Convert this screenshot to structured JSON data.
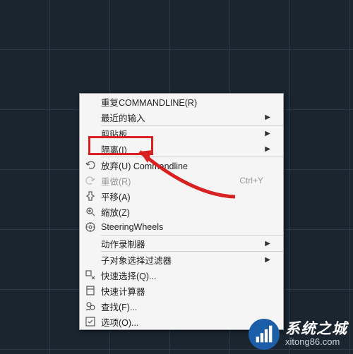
{
  "menu": {
    "groups": [
      [
        {
          "key": "repeat",
          "label": "重复COMMANDLINE(R)",
          "interact": true
        },
        {
          "key": "recent",
          "label": "最近的输入",
          "interact": true,
          "sub": true
        }
      ],
      [
        {
          "key": "clipboard",
          "label": "剪贴板",
          "interact": true,
          "sub": true
        },
        {
          "key": "isolate",
          "label": "隔离(I)",
          "interact": true,
          "sub": true
        }
      ],
      [
        {
          "key": "abandon",
          "label": "放弃(U) Commandline",
          "interact": true,
          "icon": "undo"
        },
        {
          "key": "redo",
          "label": "重做(R)",
          "interact": false,
          "shortcut": "Ctrl+Y",
          "icon": "redo",
          "disabled": true
        },
        {
          "key": "pan",
          "label": "平移(A)",
          "interact": true,
          "icon": "pan"
        },
        {
          "key": "zoom",
          "label": "缩放(Z)",
          "interact": true,
          "icon": "zoom"
        },
        {
          "key": "steering",
          "label": "SteeringWheels",
          "interact": true,
          "icon": "wheel"
        }
      ],
      [
        {
          "key": "actionrec",
          "label": "动作录制器",
          "interact": true,
          "sub": true
        }
      ],
      [
        {
          "key": "subfilter",
          "label": "子对象选择过滤器",
          "interact": true,
          "sub": true
        },
        {
          "key": "quicksel",
          "label": "快速选择(Q)...",
          "interact": true,
          "icon": "quicksel"
        },
        {
          "key": "quickcalc",
          "label": "快速计算器",
          "interact": true,
          "icon": "calc"
        },
        {
          "key": "find",
          "label": "查找(F)...",
          "interact": true,
          "icon": "find"
        },
        {
          "key": "options",
          "label": "选项(O)...",
          "interact": true,
          "icon": "check"
        }
      ]
    ]
  },
  "watermark": {
    "title": "系统之城",
    "url": "xitong86.com"
  }
}
